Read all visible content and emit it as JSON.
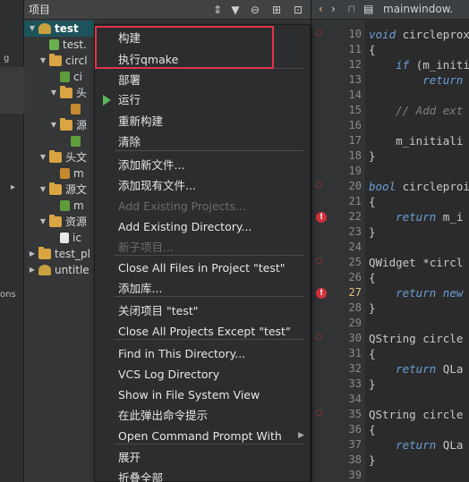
{
  "panel": {
    "title": "项目"
  },
  "tree": [
    {
      "label": "test",
      "indent": 0,
      "arrow": "▼",
      "icon": "proj",
      "selected": true
    },
    {
      "label": "test.",
      "indent": 1,
      "arrow": "",
      "icon": "pro"
    },
    {
      "label": "circl",
      "indent": 1,
      "arrow": "▼",
      "icon": "folder"
    },
    {
      "label": "ci",
      "indent": 2,
      "arrow": "",
      "icon": "cfile"
    },
    {
      "label": "头",
      "indent": 2,
      "arrow": "▼",
      "icon": "folder"
    },
    {
      "label": "",
      "indent": 3,
      "arrow": "",
      "icon": "hfile"
    },
    {
      "label": "源",
      "indent": 2,
      "arrow": "▼",
      "icon": "folder"
    },
    {
      "label": "",
      "indent": 3,
      "arrow": "",
      "icon": "cfile"
    },
    {
      "label": "头文",
      "indent": 1,
      "arrow": "▼",
      "icon": "folder"
    },
    {
      "label": "m",
      "indent": 2,
      "arrow": "",
      "icon": "hfile"
    },
    {
      "label": "源文",
      "indent": 1,
      "arrow": "▼",
      "icon": "folder"
    },
    {
      "label": "m",
      "indent": 2,
      "arrow": "",
      "icon": "cfile"
    },
    {
      "label": "资源",
      "indent": 1,
      "arrow": "▼",
      "icon": "folder"
    },
    {
      "label": "ic",
      "indent": 2,
      "arrow": "",
      "icon": "file"
    },
    {
      "label": "test_pl",
      "indent": 0,
      "arrow": "▶",
      "icon": "folder"
    },
    {
      "label": "untitle",
      "indent": 0,
      "arrow": "▶",
      "icon": "proj"
    }
  ],
  "modebar": {
    "fragments": [
      "g",
      "ons"
    ]
  },
  "menu": {
    "items": [
      {
        "label": "构建",
        "enabled": true
      },
      {
        "label": "执行qmake",
        "enabled": true
      },
      {
        "label": "部署",
        "enabled": true
      },
      {
        "label": "运行",
        "enabled": true,
        "icon": "run-icon"
      },
      {
        "label": "重新构建",
        "enabled": true
      },
      {
        "label": "清除",
        "enabled": true
      },
      {
        "label": "添加新文件...",
        "enabled": true
      },
      {
        "label": "添加现有文件...",
        "enabled": true
      },
      {
        "label": "Add Existing Projects...",
        "enabled": false
      },
      {
        "label": "Add Existing Directory...",
        "enabled": true
      },
      {
        "label": "新子项目...",
        "enabled": false
      },
      {
        "label": "Close All Files in Project \"test\"",
        "enabled": true
      },
      {
        "label": "添加库...",
        "enabled": true
      },
      {
        "label": "关闭项目 \"test\"",
        "enabled": true
      },
      {
        "label": "Close All Projects Except \"test\"",
        "enabled": true
      },
      {
        "label": "Find in This Directory...",
        "enabled": true
      },
      {
        "label": "VCS Log Directory",
        "enabled": true
      },
      {
        "label": "Show in File System View",
        "enabled": true
      },
      {
        "label": "在此弹出命令提示",
        "enabled": true
      },
      {
        "label": "Open Command Prompt With",
        "enabled": true,
        "submenu": true
      },
      {
        "label": "展开",
        "enabled": true
      },
      {
        "label": "折叠全部",
        "enabled": true
      }
    ]
  },
  "editor": {
    "tab_label": "mainwindow.",
    "lines": [
      {
        "n": "10",
        "text": "void circleprox",
        "fold": true
      },
      {
        "n": "11",
        "text": "{"
      },
      {
        "n": "12",
        "text": "    if (m_initi"
      },
      {
        "n": "13",
        "text": "        return"
      },
      {
        "n": "14",
        "text": ""
      },
      {
        "n": "15",
        "text": "    // Add ext"
      },
      {
        "n": "16",
        "text": ""
      },
      {
        "n": "17",
        "text": "    m_initiali"
      },
      {
        "n": "18",
        "text": "}"
      },
      {
        "n": "19",
        "text": ""
      },
      {
        "n": "20",
        "text": "bool circleproi",
        "fold": true
      },
      {
        "n": "21",
        "text": "{"
      },
      {
        "n": "22",
        "text": "    return m_i",
        "error": true
      },
      {
        "n": "23",
        "text": "}"
      },
      {
        "n": "24",
        "text": ""
      },
      {
        "n": "25",
        "text": "QWidget *circl",
        "fold": true
      },
      {
        "n": "26",
        "text": "{"
      },
      {
        "n": "27",
        "text": "    return new",
        "error": true,
        "current": true
      },
      {
        "n": "28",
        "text": "}"
      },
      {
        "n": "29",
        "text": ""
      },
      {
        "n": "30",
        "text": "QString circle",
        "fold": true
      },
      {
        "n": "31",
        "text": "{"
      },
      {
        "n": "32",
        "text": "    return QLa"
      },
      {
        "n": "33",
        "text": "}"
      },
      {
        "n": "34",
        "text": ""
      },
      {
        "n": "35",
        "text": "QString circle",
        "fold": true
      },
      {
        "n": "36",
        "text": "{"
      },
      {
        "n": "37",
        "text": "    return QLa"
      },
      {
        "n": "38",
        "text": "}"
      },
      {
        "n": "39",
        "text": ""
      },
      {
        "n": "40",
        "text": "QI"
      }
    ]
  },
  "colors": {
    "highlight_box": "#e0344a",
    "selection": "#1d545c",
    "run_icon": "#5cb85c"
  }
}
